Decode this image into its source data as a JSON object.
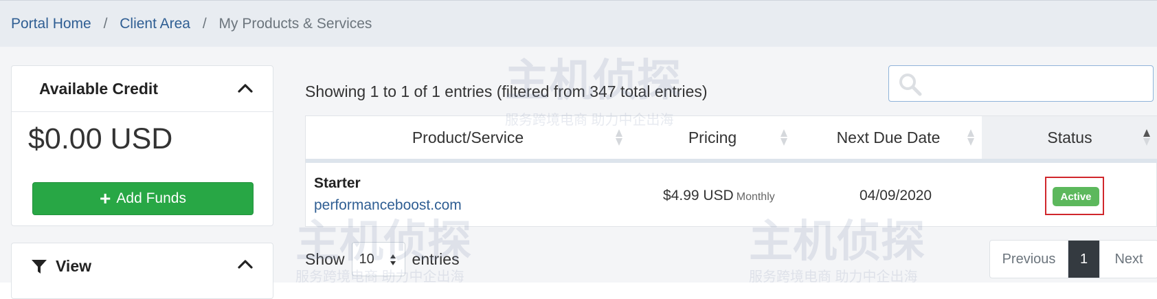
{
  "breadcrumb": {
    "items": [
      "Portal Home",
      "Client Area"
    ],
    "current": "My Products & Services",
    "separator": "/"
  },
  "sidebar": {
    "credit_card": {
      "title": "Available Credit",
      "amount": "$0.00 USD",
      "add_funds_label": "Add Funds",
      "collapse_icon": "chevron-up-icon"
    },
    "view_card": {
      "title": "View",
      "icon": "filter-icon",
      "collapse_icon": "chevron-up-icon"
    }
  },
  "main": {
    "showing_text": "Showing 1 to 1 of 1 entries (filtered from 347 total entries)",
    "search": {
      "placeholder": "",
      "value": "",
      "icon": "search-icon"
    },
    "table": {
      "columns": [
        "Product/Service",
        "Pricing",
        "Next Due Date",
        "Status"
      ],
      "rows": [
        {
          "product": "Starter",
          "domain": "performanceboost.com",
          "price": "$4.99 USD",
          "cycle": "Monthly",
          "due_date": "04/09/2020",
          "status": "Active"
        }
      ]
    },
    "length": {
      "show_label": "Show",
      "value": "10",
      "entries_label": "entries"
    },
    "pagination": {
      "previous": "Previous",
      "current": "1",
      "next": "Next"
    }
  },
  "watermark": {
    "main": "主机侦探",
    "sub": "服务跨境电商 助力中企出海"
  },
  "colors": {
    "link": "#2f5e93",
    "success": "#28a745",
    "badge_active": "#5cb85c",
    "highlight_box": "#d0262b",
    "pager_active": "#343a40"
  }
}
